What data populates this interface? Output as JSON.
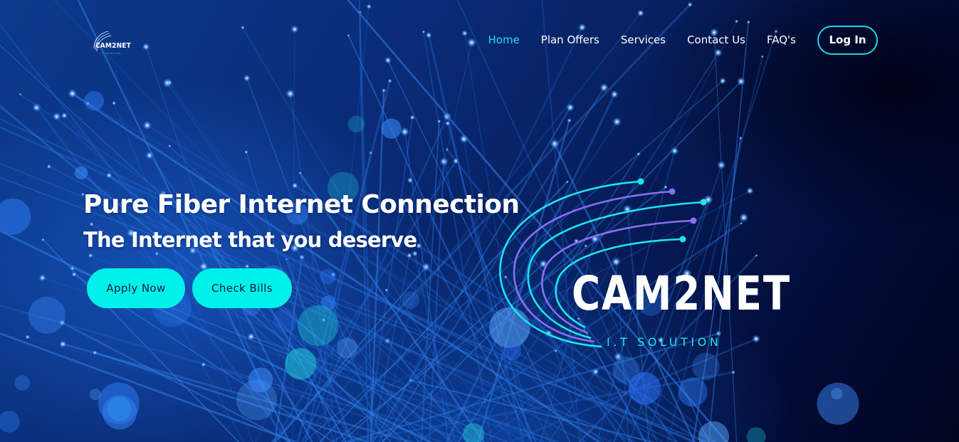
{
  "brand": {
    "name": "CAM2NET",
    "tagline": "I.T SOLUTION",
    "accent_color": "#00f0ea",
    "purple_accent": "#7b6cf0"
  },
  "nav": {
    "items": [
      {
        "label": "Home",
        "active": true
      },
      {
        "label": "Plan Offers",
        "active": false
      },
      {
        "label": "Services",
        "active": false
      },
      {
        "label": "Contact Us",
        "active": false
      },
      {
        "label": "FAQ's",
        "active": false
      }
    ],
    "login_label": "Log In"
  },
  "hero": {
    "headline": "Pure Fiber Internet Connection",
    "subheadline": "The Internet that you deserve",
    "apply_label": "Apply Now",
    "bills_label": "Check Bills",
    "background": "fiber-optic-strands"
  }
}
